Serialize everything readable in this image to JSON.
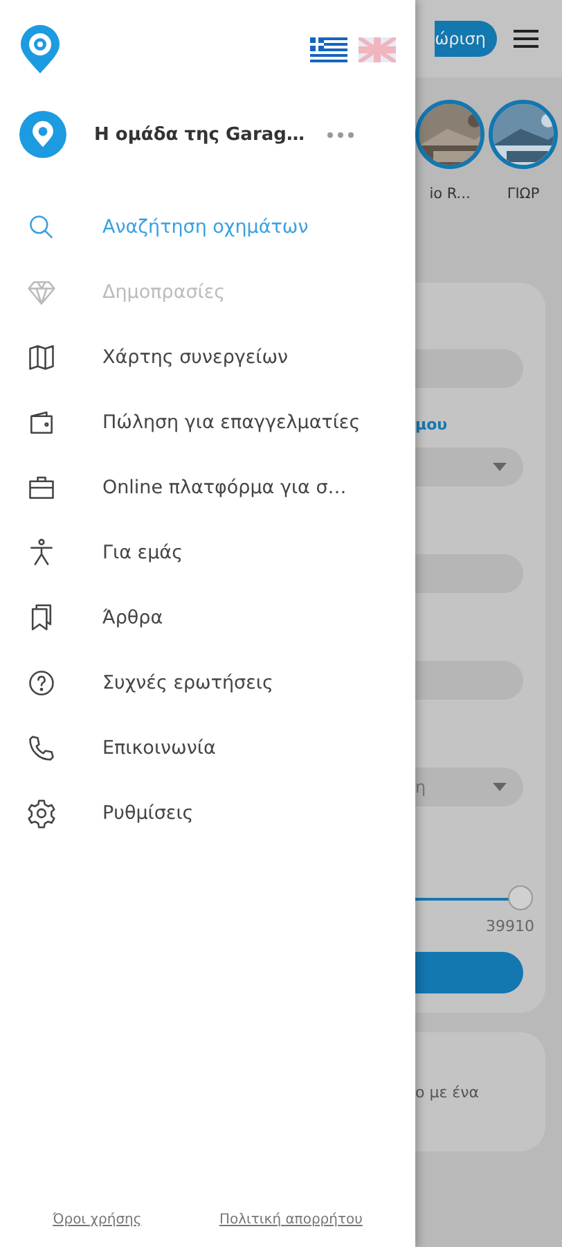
{
  "drawer": {
    "team": {
      "name": "Η ομάδα της Garag…"
    },
    "menu": [
      {
        "kind": "search",
        "label": "Αναζήτηση οχημάτων",
        "selected": true,
        "disabled": false
      },
      {
        "kind": "diamond",
        "label": "Δημοπρασίες",
        "selected": false,
        "disabled": true
      },
      {
        "kind": "map",
        "label": "Χάρτης συνεργείων",
        "selected": false,
        "disabled": false
      },
      {
        "kind": "wallet",
        "label": "Πώληση για επαγγελματίες",
        "selected": false,
        "disabled": false
      },
      {
        "kind": "briefcase",
        "label": "Online πλατφόρμα για σ…",
        "selected": false,
        "disabled": false
      },
      {
        "kind": "person",
        "label": "Για εμάς",
        "selected": false,
        "disabled": false
      },
      {
        "kind": "bookmark",
        "label": "Άρθρα",
        "selected": false,
        "disabled": false
      },
      {
        "kind": "help",
        "label": "Συχνές ερωτήσεις",
        "selected": false,
        "disabled": false
      },
      {
        "kind": "phone",
        "label": "Επικοινωνία",
        "selected": false,
        "disabled": false
      },
      {
        "kind": "settings",
        "label": "Ρυθμίσεις",
        "selected": false,
        "disabled": false
      }
    ],
    "footer_links": [
      "Όροι χρήσης",
      "Πολιτική απορρήτου"
    ]
  },
  "background": {
    "header_button": "ώριση",
    "stories": [
      {
        "label": "io R..."
      },
      {
        "label": "ΓΙΩΡ"
      }
    ],
    "form": {
      "section_label": "μου",
      "dropdown_value": "η",
      "slider": {
        "level": 0.97,
        "reading": "39910"
      }
    },
    "card_text": "ο με ένα"
  }
}
